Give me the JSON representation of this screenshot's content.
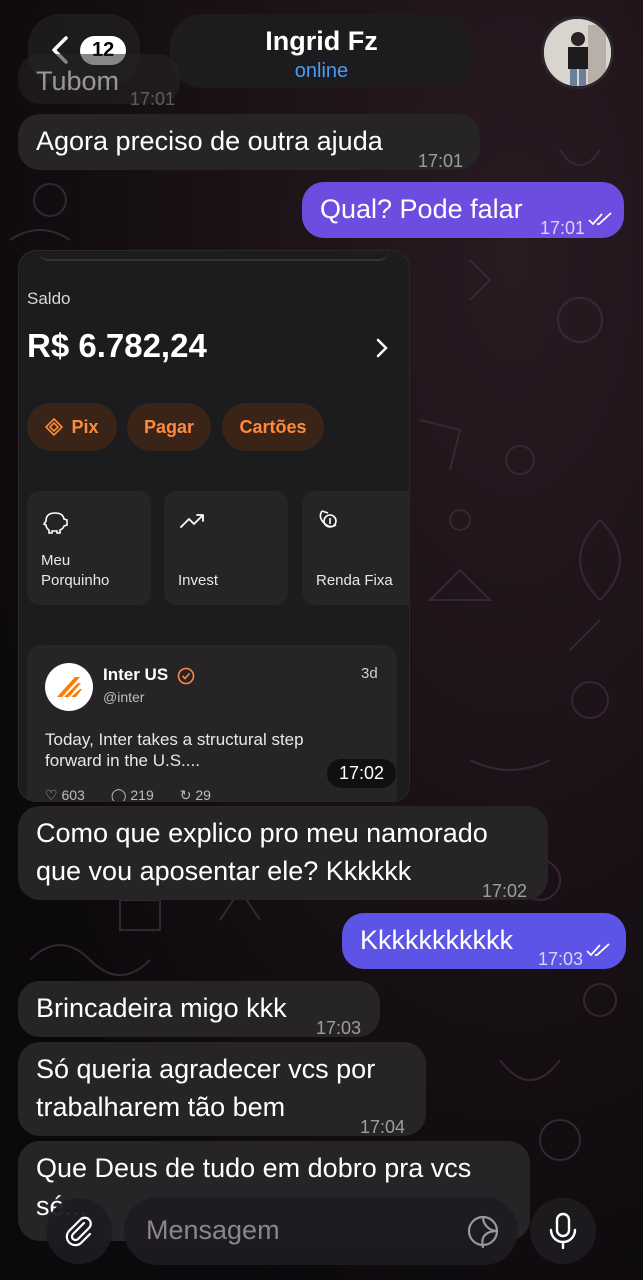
{
  "header": {
    "unread_count": "12",
    "contact_name": "Ingrid Fz",
    "contact_status": "online"
  },
  "messages": [
    {
      "dir": "in",
      "text": "Agora preciso de outra ajuda",
      "time": "17:01"
    },
    {
      "dir": "out",
      "text": "Qual? Pode falar",
      "time": "17:01"
    },
    {
      "dir": "in",
      "text": "Como que explico pro meu namorado",
      "text2": "que vou aposentar ele? Kkkkkk",
      "time": "17:02"
    },
    {
      "dir": "out",
      "text": "Kkkkkkkkkkk",
      "time": "17:03"
    },
    {
      "dir": "in",
      "text": "Brincadeira migo kkk",
      "time": "17:03"
    },
    {
      "dir": "in",
      "text": "Só queria agradecer vcs por",
      "text2": "trabalharem tão bem",
      "time": "17:04"
    },
    {
      "dir": "in",
      "text": "Que Deus de tudo em dobro pra vcs",
      "text2": "sé..."
    }
  ],
  "partial_message": {
    "text": "Tubom",
    "time": "17:01"
  },
  "image_message": {
    "time": "17:02",
    "saldo_label": "Saldo",
    "saldo_value": "R$ 6.782,24",
    "buttons": [
      "Pix",
      "Pagar",
      "Cartões"
    ],
    "tiles": [
      {
        "label": "Meu Porquinho",
        "icon": "piggy-bank-icon"
      },
      {
        "label": "Invest",
        "icon": "trend-up-icon"
      },
      {
        "label": "Renda Fixa",
        "icon": "renda-fixa-icon"
      }
    ],
    "post": {
      "author": "Inter US",
      "handle": "@inter",
      "age": "3d",
      "text": "Today, Inter takes a structural step forward in the U.S....",
      "likes": "603",
      "comments": "219",
      "reposts": "29"
    }
  },
  "input": {
    "placeholder": "Mensagem"
  },
  "colors": {
    "incoming_bubble": "#262427",
    "outgoing_bubble": "#6c4de0",
    "accent_orange": "#ff8a3d",
    "status_blue": "#4a9cf0"
  }
}
